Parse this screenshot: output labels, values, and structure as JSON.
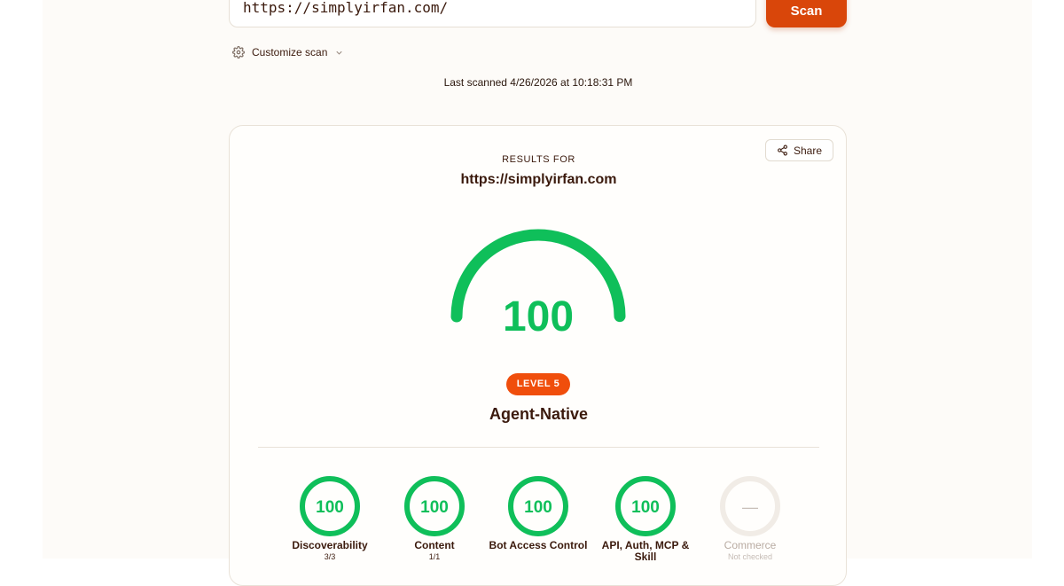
{
  "scan_form": {
    "url_value": "https://simplyirfan.com/",
    "scan_label": "Scan",
    "customize_label": "Customize scan",
    "last_scanned": "Last scanned 4/26/2026 at 10:18:31 PM"
  },
  "results": {
    "share_label": "Share",
    "heading": "RESULTS FOR",
    "url": "https://simplyirfan.com",
    "score": "100",
    "score_value": 100,
    "score_max": 100,
    "level_badge": "LEVEL 5",
    "level_name": "Agent-Native",
    "categories": [
      {
        "name": "Discoverability",
        "score": "100",
        "value": 100,
        "sub": "3/3",
        "state": "checked"
      },
      {
        "name": "Content",
        "score": "100",
        "value": 100,
        "sub": "1/1",
        "state": "checked"
      },
      {
        "name": "Bot Access Control",
        "score": "100",
        "value": 100,
        "sub": "",
        "state": "checked"
      },
      {
        "name": "API, Auth, MCP & Skill",
        "score": "100",
        "value": 100,
        "sub": "",
        "state": "checked"
      },
      {
        "name": "Commerce",
        "score": "—",
        "value": null,
        "sub": "Not checked",
        "state": "not-checked"
      }
    ]
  },
  "colors": {
    "accent": "#d9460a",
    "badge": "#f04e0c",
    "success": "#0fbf5a",
    "text": "#3b1a0d",
    "muted_ring": "#f1ece6"
  },
  "icons": {
    "customize": "gear-icon",
    "chevron": "chevron-down-icon",
    "share": "share-icon"
  }
}
